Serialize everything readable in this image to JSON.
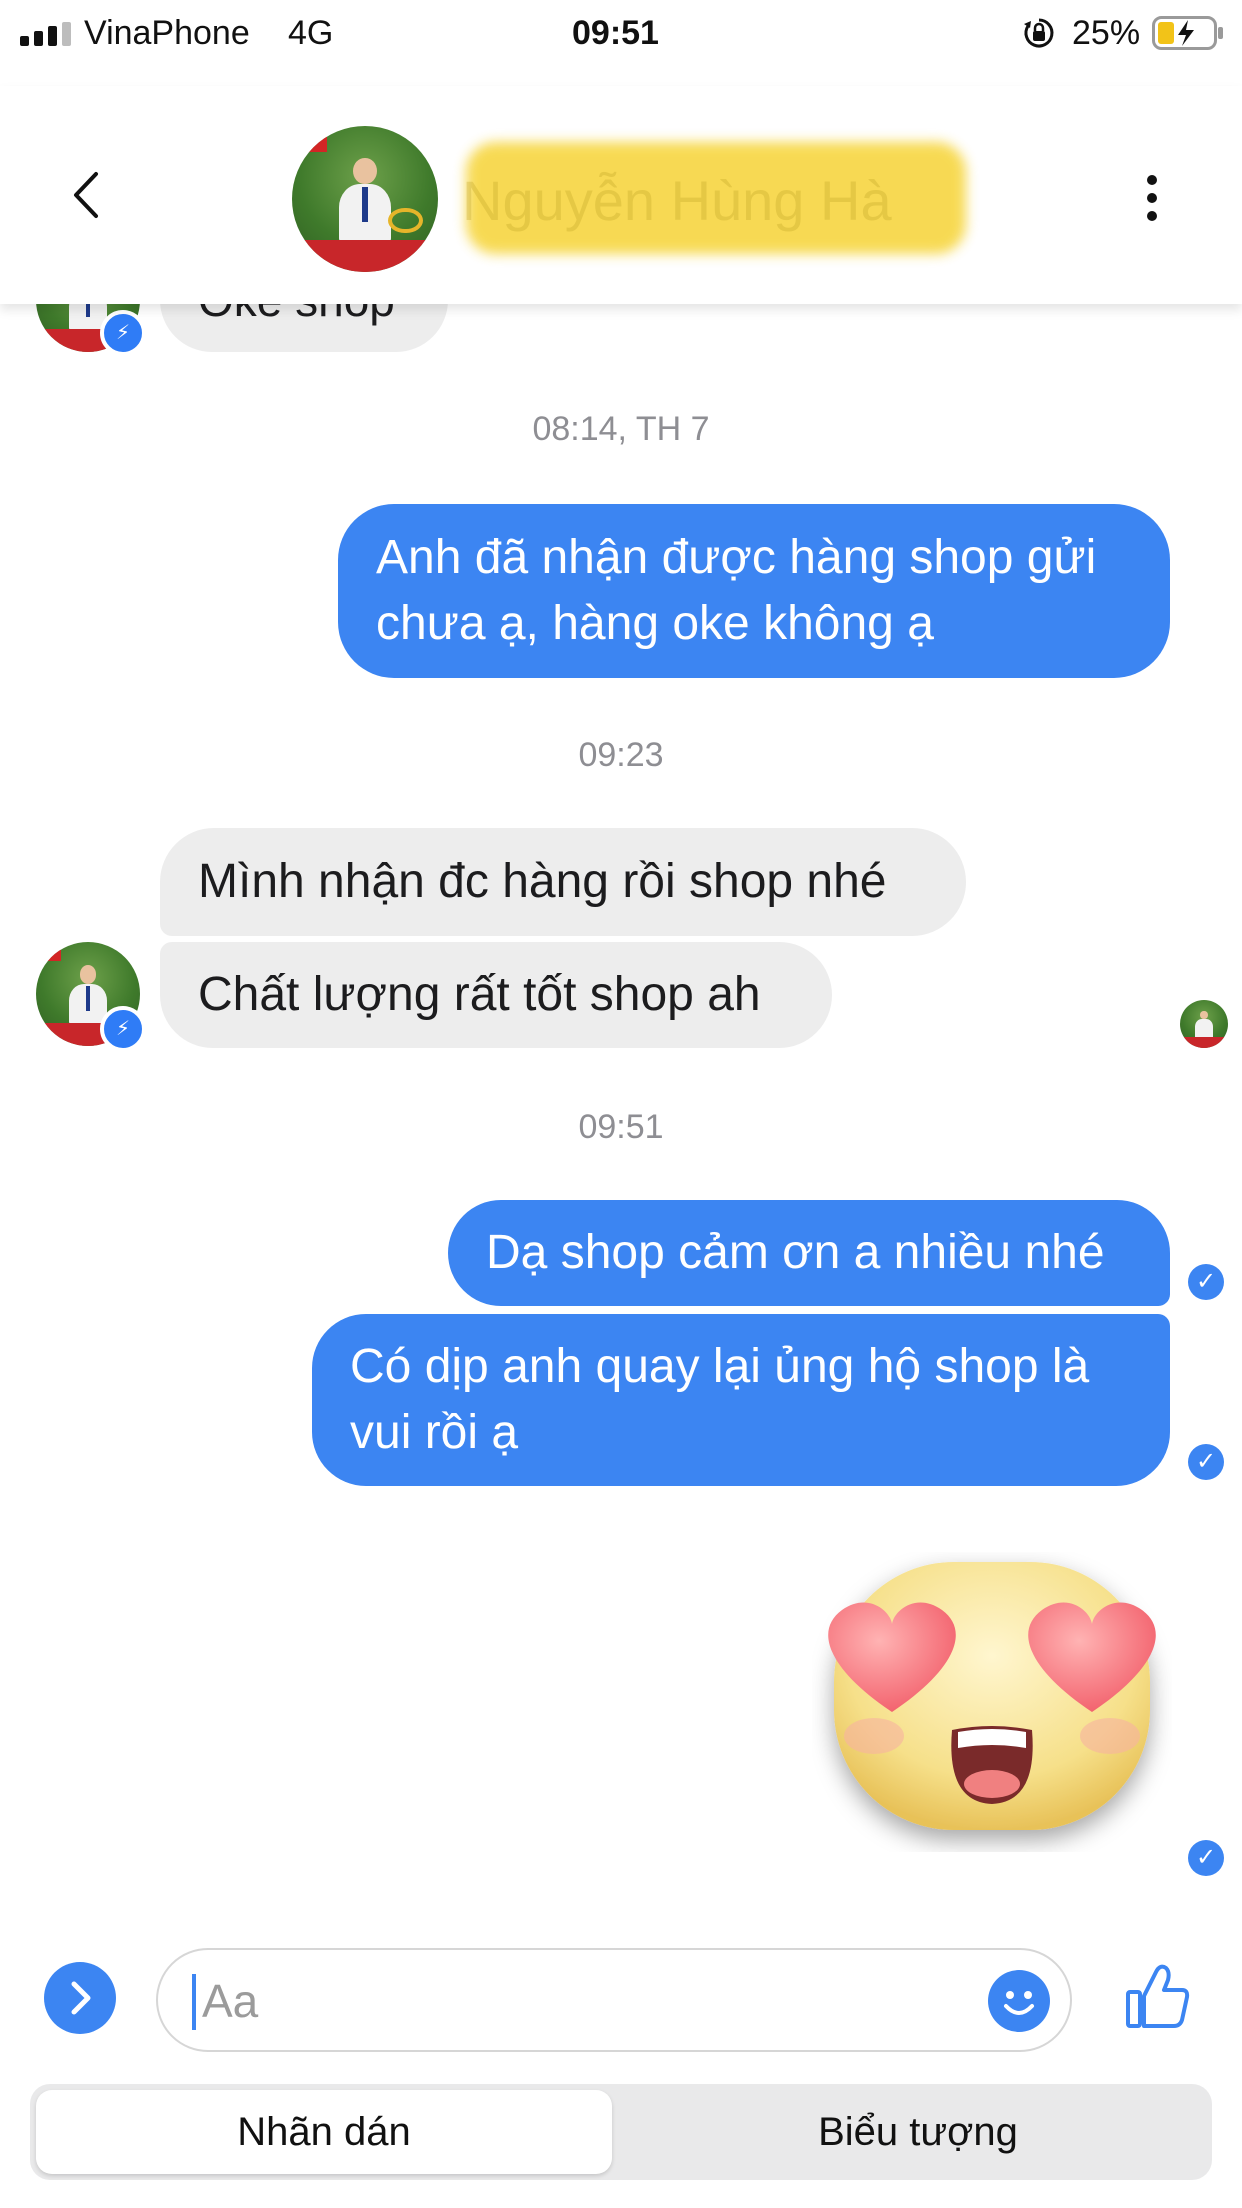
{
  "status_bar": {
    "carrier": "VinaPhone",
    "network": "4G",
    "time": "09:51",
    "battery": "25%",
    "battery_level": 0.25
  },
  "header": {
    "contact_name": "Nguyễn Hùng Hà",
    "back_icon": "chevron-left-icon",
    "more_icon": "more-vertical-icon"
  },
  "conversation": {
    "previous_message": "Oke shop",
    "timestamps": [
      "08:14, TH 7",
      "09:23",
      "09:51"
    ],
    "outgoing_1": {
      "line1": "Anh đã nhận được hàng shop gửi",
      "line2": "chưa ạ, hàng oke không ạ"
    },
    "incoming": [
      "Mình nhận đc hàng rồi shop nhé",
      "Chất lượng rất tốt shop ah"
    ],
    "outgoing_2": "Dạ shop cảm ơn a nhiều nhé",
    "outgoing_3": {
      "line1": "Có dịp anh quay lại ủng hộ shop là",
      "line2": "vui rồi ạ"
    },
    "sticker": "heart-eyes-emoji"
  },
  "composer": {
    "placeholder": "Aa",
    "expand_icon": "chevron-right-icon",
    "emoji_icon": "smiley-icon",
    "like_icon": "thumbs-up-icon"
  },
  "tabs": [
    "Nhãn dán",
    "Biểu tượng"
  ],
  "colors": {
    "accent": "#3c85f2",
    "incoming_bubble": "#ededed"
  }
}
